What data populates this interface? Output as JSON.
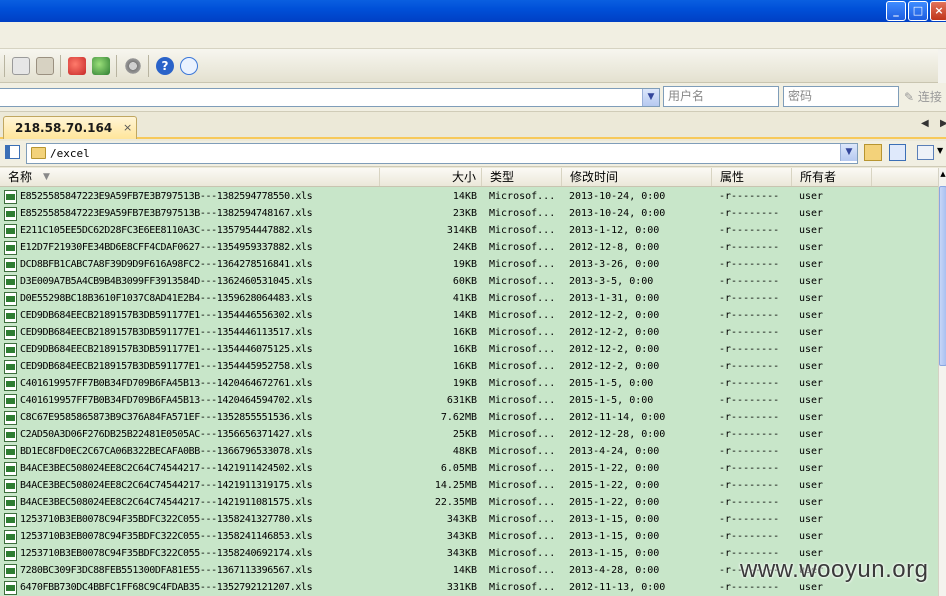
{
  "window": {
    "min": "_",
    "max": "□",
    "close": "×"
  },
  "toolbar": {
    "icons": [
      "copy-icon",
      "paste-icon",
      "transfer-red-icon",
      "transfer-green-icon",
      "settings-gear-icon",
      "help-icon",
      "message-icon"
    ]
  },
  "connection": {
    "host_value": "",
    "username_placeholder": "用户名",
    "password_placeholder": "密码",
    "connect_label": "连接"
  },
  "tabs": [
    {
      "label": "218.58.70.164",
      "close": "×"
    }
  ],
  "path": {
    "value": "/excel"
  },
  "columns": {
    "name": "名称",
    "size": "大小",
    "type": "类型",
    "modified": "修改时间",
    "attr": "属性",
    "owner": "所有者"
  },
  "files": [
    {
      "name": "E8525585847223E9A59FB7E3B797513B---1382594778550.xls",
      "size": "14KB",
      "type": "Microsof...",
      "modified": "2013-10-24, 0:00",
      "attr": "-r--------",
      "owner": "user"
    },
    {
      "name": "E8525585847223E9A59FB7E3B797513B---1382594748167.xls",
      "size": "23KB",
      "type": "Microsof...",
      "modified": "2013-10-24, 0:00",
      "attr": "-r--------",
      "owner": "user"
    },
    {
      "name": "E211C105EE5DC62D28FC3E6EE8110A3C---1357954447882.xls",
      "size": "314KB",
      "type": "Microsof...",
      "modified": "2013-1-12, 0:00",
      "attr": "-r--------",
      "owner": "user"
    },
    {
      "name": "E12D7F21930FE34BD6E8CFF4CDAF0627---1354959337882.xls",
      "size": "24KB",
      "type": "Microsof...",
      "modified": "2012-12-8, 0:00",
      "attr": "-r--------",
      "owner": "user"
    },
    {
      "name": "DCD8BFB1CABC7A8F39D9D9F616A98FC2---1364278516841.xls",
      "size": "19KB",
      "type": "Microsof...",
      "modified": "2013-3-26, 0:00",
      "attr": "-r--------",
      "owner": "user"
    },
    {
      "name": "D3E009A7B5A4CB9B4B3099FF3913584D---1362460531045.xls",
      "size": "60KB",
      "type": "Microsof...",
      "modified": "2013-3-5, 0:00",
      "attr": "-r--------",
      "owner": "user"
    },
    {
      "name": "D0E55298BC18B3610F1037C8AD41E2B4---1359628064483.xls",
      "size": "41KB",
      "type": "Microsof...",
      "modified": "2013-1-31, 0:00",
      "attr": "-r--------",
      "owner": "user"
    },
    {
      "name": "CED9DB684EECB2189157B3DB591177E1---1354446556302.xls",
      "size": "14KB",
      "type": "Microsof...",
      "modified": "2012-12-2, 0:00",
      "attr": "-r--------",
      "owner": "user"
    },
    {
      "name": "CED9DB684EECB2189157B3DB591177E1---1354446113517.xls",
      "size": "16KB",
      "type": "Microsof...",
      "modified": "2012-12-2, 0:00",
      "attr": "-r--------",
      "owner": "user"
    },
    {
      "name": "CED9DB684EECB2189157B3DB591177E1---1354446075125.xls",
      "size": "16KB",
      "type": "Microsof...",
      "modified": "2012-12-2, 0:00",
      "attr": "-r--------",
      "owner": "user"
    },
    {
      "name": "CED9DB684EECB2189157B3DB591177E1---1354445952758.xls",
      "size": "16KB",
      "type": "Microsof...",
      "modified": "2012-12-2, 0:00",
      "attr": "-r--------",
      "owner": "user"
    },
    {
      "name": "C401619957FF7B0B34FD709B6FA45B13---1420464672761.xls",
      "size": "19KB",
      "type": "Microsof...",
      "modified": "2015-1-5, 0:00",
      "attr": "-r--------",
      "owner": "user"
    },
    {
      "name": "C401619957FF7B0B34FD709B6FA45B13---1420464594702.xls",
      "size": "631KB",
      "type": "Microsof...",
      "modified": "2015-1-5, 0:00",
      "attr": "-r--------",
      "owner": "user"
    },
    {
      "name": "C8C67E9585865873B9C376A84FA571EF---1352855551536.xls",
      "size": "7.62MB",
      "type": "Microsof...",
      "modified": "2012-11-14, 0:00",
      "attr": "-r--------",
      "owner": "user"
    },
    {
      "name": "C2AD50A3D06F276DB25B22481E0505AC---1356656371427.xls",
      "size": "25KB",
      "type": "Microsof...",
      "modified": "2012-12-28, 0:00",
      "attr": "-r--------",
      "owner": "user"
    },
    {
      "name": "BD1EC8FD0EC2C67CA06B322BECAFA0BB---1366796533078.xls",
      "size": "48KB",
      "type": "Microsof...",
      "modified": "2013-4-24, 0:00",
      "attr": "-r--------",
      "owner": "user"
    },
    {
      "name": "B4ACE3BEC508024EE8C2C64C74544217---1421911424502.xls",
      "size": "6.05MB",
      "type": "Microsof...",
      "modified": "2015-1-22, 0:00",
      "attr": "-r--------",
      "owner": "user"
    },
    {
      "name": "B4ACE3BEC508024EE8C2C64C74544217---1421911319175.xls",
      "size": "14.25MB",
      "type": "Microsof...",
      "modified": "2015-1-22, 0:00",
      "attr": "-r--------",
      "owner": "user"
    },
    {
      "name": "B4ACE3BEC508024EE8C2C64C74544217---1421911081575.xls",
      "size": "22.35MB",
      "type": "Microsof...",
      "modified": "2015-1-22, 0:00",
      "attr": "-r--------",
      "owner": "user"
    },
    {
      "name": "1253710B3EB0078C94F35BDFC322C055---1358241327780.xls",
      "size": "343KB",
      "type": "Microsof...",
      "modified": "2013-1-15, 0:00",
      "attr": "-r--------",
      "owner": "user"
    },
    {
      "name": "1253710B3EB0078C94F35BDFC322C055---1358241146853.xls",
      "size": "343KB",
      "type": "Microsof...",
      "modified": "2013-1-15, 0:00",
      "attr": "-r--------",
      "owner": "user"
    },
    {
      "name": "1253710B3EB0078C94F35BDFC322C055---1358240692174.xls",
      "size": "343KB",
      "type": "Microsof...",
      "modified": "2013-1-15, 0:00",
      "attr": "-r--------",
      "owner": "user"
    },
    {
      "name": "7280BC309F3DC88FEB551300DFA81E55---1367113396567.xls",
      "size": "14KB",
      "type": "Microsof...",
      "modified": "2013-4-28, 0:00",
      "attr": "-r--------",
      "owner": "user"
    },
    {
      "name": "6470FBB730DC4BBFC1FF68C9C4FDAB35---1352792121207.xls",
      "size": "331KB",
      "type": "Microsof...",
      "modified": "2012-11-13, 0:00",
      "attr": "-r--------",
      "owner": "user"
    }
  ],
  "watermark": "www.wooyun.org",
  "colors": {
    "titlebar": "#0050d8",
    "list_bg": "#c8e6c9",
    "tab_bg": "#ffe59a"
  }
}
